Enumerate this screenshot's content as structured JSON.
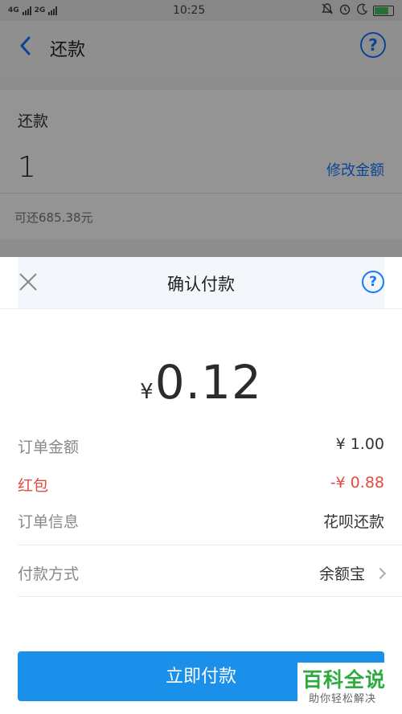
{
  "status_bar": {
    "network_left": "4G",
    "network_right": "2G",
    "time": "10:25"
  },
  "header": {
    "title": "还款",
    "back_icon": "chevron-left-icon",
    "help_icon": "question-circle-icon",
    "help_glyph": "?"
  },
  "repayment": {
    "label": "还款",
    "amount": "1",
    "edit_link": "修改金额",
    "available": "可还685.38元"
  },
  "sheet": {
    "title": "确认付款",
    "close_icon": "close-icon",
    "help_glyph": "?",
    "currency_symbol": "¥",
    "amount": "0.12",
    "rows": [
      {
        "label": "订单金额",
        "value": "¥ 1.00"
      },
      {
        "label": "红包",
        "value": "-¥ 0.88"
      },
      {
        "label": "订单信息",
        "value": "花呗还款"
      },
      {
        "label": "付款方式",
        "value": "余额宝"
      }
    ],
    "pay_button": "立即付款"
  },
  "watermark": {
    "main": "百科全说",
    "sub": "助你轻松解决"
  },
  "colors": {
    "accent": "#1677ff",
    "button": "#1a90ea",
    "discount": "#e24b3e"
  }
}
